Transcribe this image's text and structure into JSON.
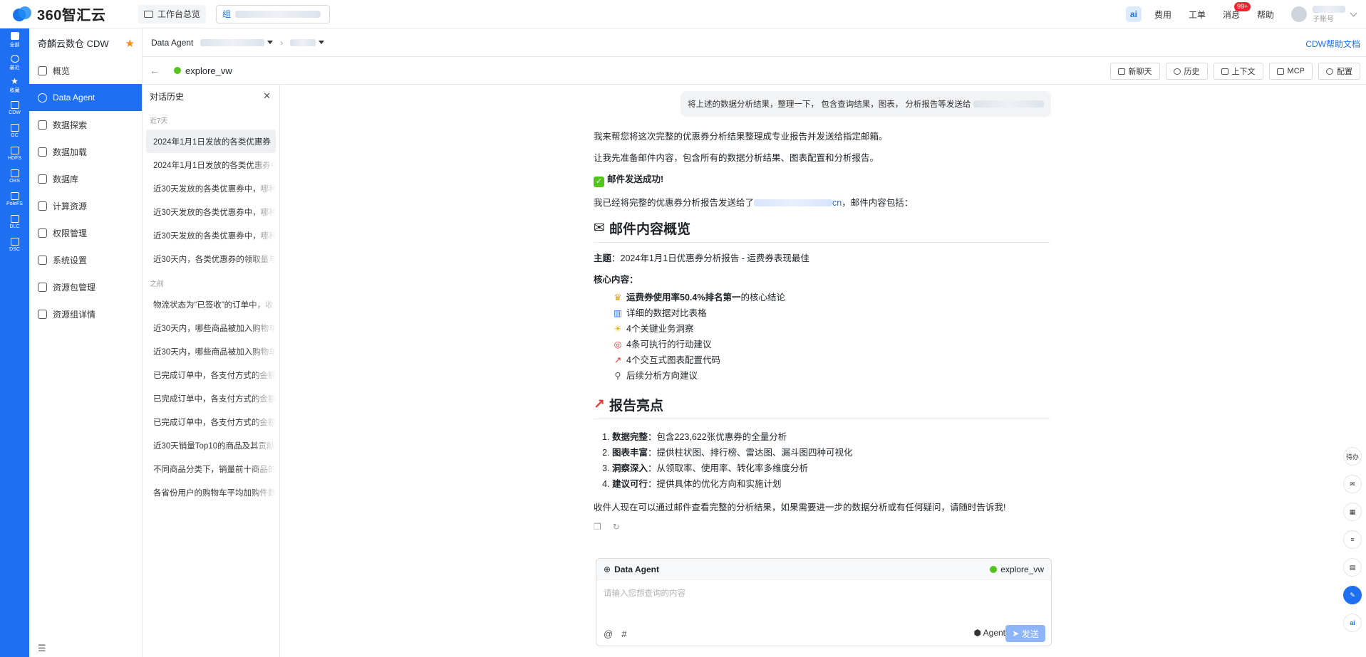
{
  "topbar": {
    "logo_text": "360智汇云",
    "workspace_overview": "工作台总览",
    "group_prefix": "组",
    "ai_label": "ai",
    "links": [
      "费用",
      "工单",
      "消息",
      "帮助"
    ],
    "message_badge": "99+",
    "user_sub": "子账号"
  },
  "rail": {
    "items": [
      "全部",
      "最近",
      "收藏",
      "CDW",
      "GC",
      "HDFS",
      "OBS",
      "PoleFS",
      "DLC",
      "DSC"
    ]
  },
  "sidebar": {
    "title": "奇麟云数仓 CDW",
    "items": [
      "概览",
      "Data Agent",
      "数据探索",
      "数据加载",
      "数据库",
      "计算资源",
      "权限管理",
      "系统设置",
      "资源包管理",
      "资源组详情"
    ]
  },
  "breadcrumb": {
    "root": "Data Agent",
    "help": "CDW帮助文档"
  },
  "subheader": {
    "workspace": "explore_vw",
    "buttons": [
      "新聊天",
      "历史",
      "上下文",
      "MCP",
      "配置"
    ]
  },
  "history": {
    "title": "对话历史",
    "group_recent": "近7天",
    "recent": [
      "2024年1月1日发放的各类优惠券",
      "2024年1月1日发放的各类优惠券中",
      "近30天发放的各类优惠券中，哪种",
      "近30天发放的各类优惠券中，哪种",
      "近30天发放的各类优惠券中，哪种",
      "近30天内，各类优惠券的领取量与"
    ],
    "group_before": "之前",
    "before": [
      "物流状态为“已签收”的订单中，收",
      "近30天内，哪些商品被加入购物车",
      "近30天内，哪些商品被加入购物车",
      "已完成订单中，各支付方式的金额",
      "已完成订单中，各支付方式的金额",
      "已完成订单中，各支付方式的金额",
      "近30天销量Top10的商品及其贡献",
      "不同商品分类下，销量前十商品的",
      "各省份用户的购物车平均加购件数"
    ]
  },
  "chat": {
    "user_message": "将上述的数据分析结果，整理一下， 包含查询结果，图表， 分析报告等发送给",
    "p1": "我来帮您将这次完整的优惠券分析结果整理成专业报告并发送给指定邮箱。",
    "p2": "让我先准备邮件内容，包含所有的数据分析结果、图表配置和分析报告。",
    "success": "邮件发送成功!",
    "sent_prefix": "我已经将完整的优惠券分析报告发送给了",
    "sent_domain": "cn",
    "sent_suffix": "，邮件内容包括：",
    "h_overview": "邮件内容概览",
    "subject_label": "主题",
    "subject": "2024年1月1日优惠券分析报告 - 运费券表现最佳",
    "core_label": "核心内容",
    "core_first_bold": "运费券使用率50.4%排名第一",
    "core_first_rest": "的核心结论",
    "core_items": [
      "详细的数据对比表格",
      "4个关键业务洞察",
      "4条可执行的行动建议",
      "4个交互式图表配置代码",
      "后续分析方向建议"
    ],
    "h_highlights": "报告亮点",
    "highlights": [
      {
        "label": "数据完整",
        "text": "包含223,622张优惠券的全量分析"
      },
      {
        "label": "图表丰富",
        "text": "提供柱状图、排行榜、雷达图、漏斗图四种可视化"
      },
      {
        "label": "洞察深入",
        "text": "从领取率、使用率、转化率多维度分析"
      },
      {
        "label": "建议可行",
        "text": "提供具体的优化方向和实施计划"
      }
    ],
    "closing": "收件人现在可以通过邮件查看完整的分析结果，如果需要进一步的数据分析或有任何疑问，请随时告诉我!"
  },
  "input": {
    "title": "Data Agent",
    "workspace": "explore_vw",
    "placeholder": "请输入您想查询的内容",
    "at": "@",
    "hash": "#",
    "agent": "Agent",
    "send": "发送"
  },
  "right_float": [
    "待办"
  ]
}
